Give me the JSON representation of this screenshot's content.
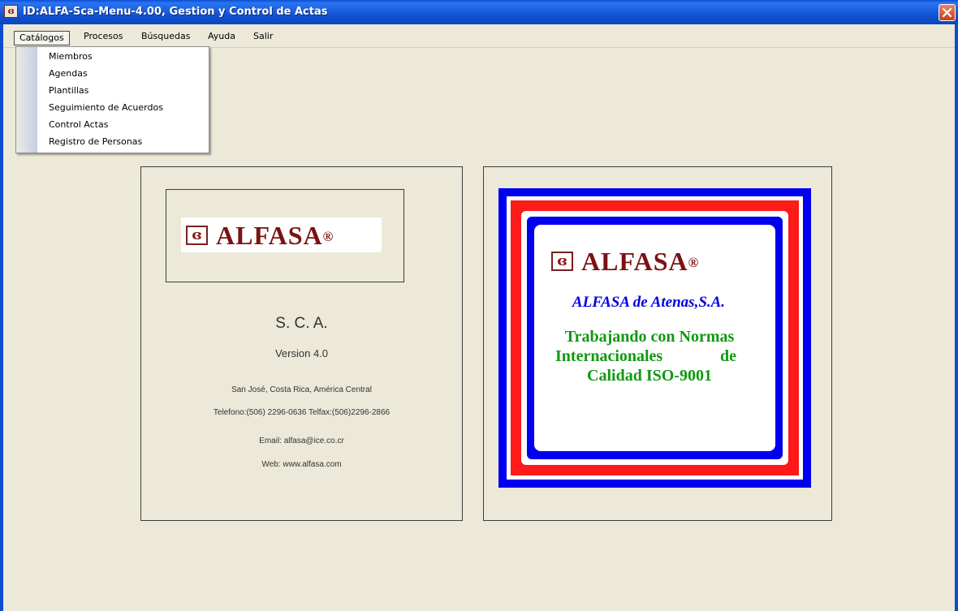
{
  "window": {
    "title": "ID:ALFA-Sca-Menu-4.00, Gestion y Control de Actas",
    "app_icon": "ɞ"
  },
  "menubar": {
    "items": [
      "Catálogos",
      "Procesos",
      "Búsquedas",
      "Ayuda",
      "Salir"
    ]
  },
  "dropdown": {
    "items": [
      "Miembros",
      "Agendas",
      "Plantillas",
      "Seguimiento de Acuerdos",
      "Control Actas",
      "Registro de Personas"
    ]
  },
  "left_panel": {
    "logo_glyph": "ɞ",
    "logo_word": "ALFASA",
    "logo_mark": "®",
    "product": "S. C. A.",
    "version": "Version 4.0",
    "address": "San José, Costa Rica, América Central",
    "phones": "Telefono:(506) 2296-0636  Telfax:(506)2296-2866",
    "email": "Email: alfasa@ice.co.cr",
    "web": "Web: www.alfasa.com"
  },
  "right_panel": {
    "logo_glyph": "ɞ",
    "logo_word": "ALFASA",
    "logo_mark": "®",
    "company": "ALFASA de Atenas,S.A.",
    "slogan_line1": "Trabajando con Normas",
    "slogan_line2a": "Internacionales",
    "slogan_line2b": "de",
    "slogan_line3": "Calidad ISO-9001"
  },
  "colors": {
    "titlebar": "#0a4fd8",
    "window_bg": "#ece9d8",
    "logo_red": "#7a1212",
    "ring_blue": "#0000ee",
    "ring_red": "#ff1a1a",
    "slogan_green": "#119911"
  },
  "icons": {
    "app": "app-icon",
    "close": "close-icon"
  }
}
